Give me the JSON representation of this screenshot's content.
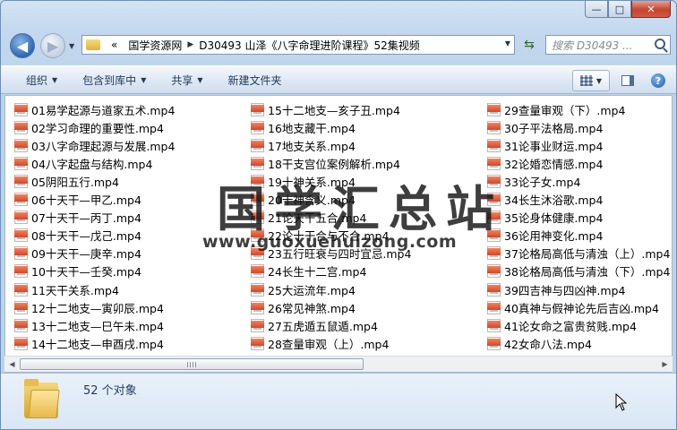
{
  "window": {
    "caption_buttons": {
      "minimize": "—",
      "maximize": "□",
      "close": "✕"
    }
  },
  "nav": {
    "back_icon": "back-arrow-icon",
    "forward_icon": "forward-arrow-icon",
    "breadcrumb_overflow": "«",
    "breadcrumb": [
      "国学资源网",
      "D30493 山泽《八字命理进阶课程》52集视频"
    ],
    "search_placeholder": "搜索 D30493 ..."
  },
  "toolbar": {
    "organize": "组织",
    "include_in_library": "包含到库中",
    "share": "共享",
    "new_folder": "新建文件夹",
    "help": "?"
  },
  "watermark": {
    "title": "国学汇总站",
    "url": "www.guoxuehuizong.com"
  },
  "files": {
    "col1": [
      "01易学起源与道家五术.mp4",
      "02学习命理的重要性.mp4",
      "03八字命理起源与发展.mp4",
      "04八字起盘与结构.mp4",
      "05阴阳五行.mp4",
      "06十天干—甲乙.mp4",
      "07十天干—丙丁.mp4",
      "08十天干—戊己.mp4",
      "09十天干—庚辛.mp4",
      "10十天干—壬癸.mp4",
      "11天干关系.mp4",
      "12十二地支—寅卯辰.mp4",
      "13十二地支—巳午未.mp4",
      "14十二地支—申酉戌.mp4"
    ],
    "col2": [
      "15十二地支—亥子丑.mp4",
      "16地支藏干.mp4",
      "17地支关系.mp4",
      "18干支宫位案例解析.mp4",
      "19十神关系.mp4",
      "20十神含义.mp4",
      "21论天干五合.mp4",
      "22论十干合与不合.mp4",
      "23五行旺衰与四时宜忌.mp4",
      "24长生十二宫.mp4",
      "25大运流年.mp4",
      "26常见神煞.mp4",
      "27五虎遁五鼠遁.mp4",
      "28查量审观（上）.mp4"
    ],
    "col3": [
      "29查量审观（下）.mp4",
      "30子平法格局.mp4",
      "31论事业财运.mp4",
      "32论婚恋情感.mp4",
      "33论子女.mp4",
      "34长生沐浴歌.mp4",
      "35论身体健康.mp4",
      "36论用神变化.mp4",
      "37论格局高低与清浊（上）.mp4",
      "38论格局高低与清浊（下）.mp4",
      "39四吉神与四凶神.mp4",
      "40真神与假神论先后吉凶.mp4",
      "41论女命之富贵贫贱.mp4",
      "42女命八法.mp4"
    ]
  },
  "status": {
    "item_count": "52 个对象"
  }
}
